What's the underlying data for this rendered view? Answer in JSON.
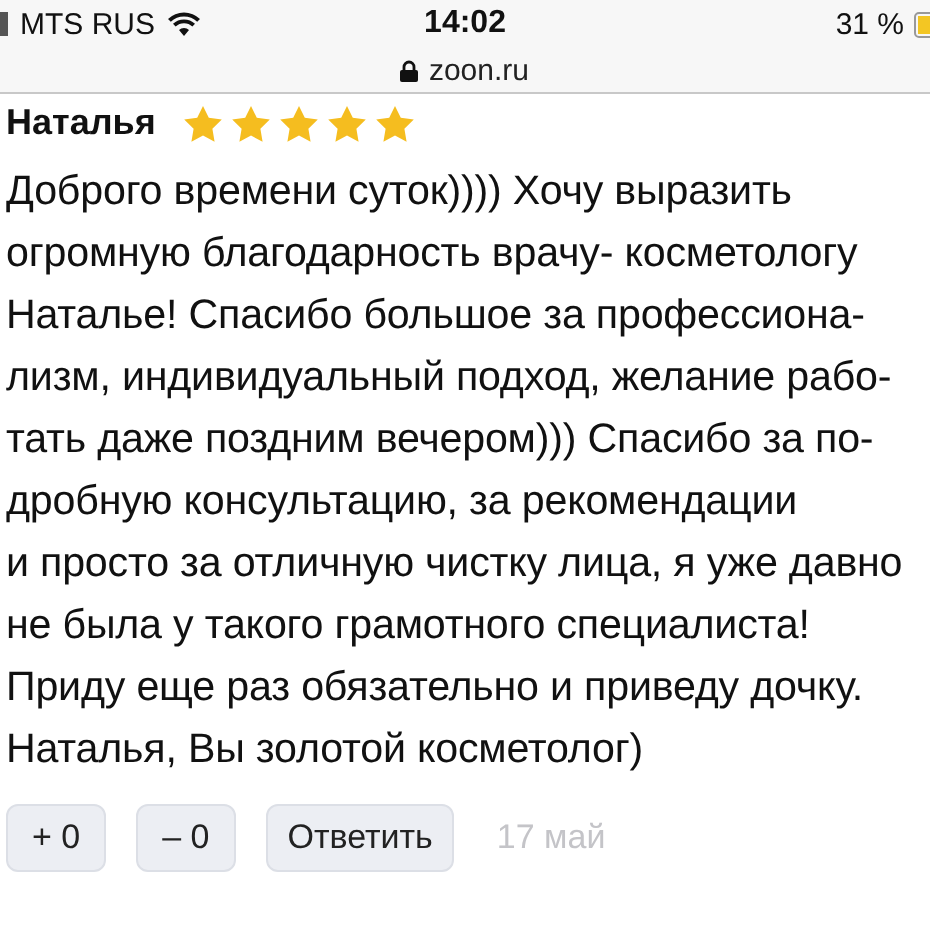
{
  "status_bar": {
    "carrier": "MTS RUS",
    "time": "14:02",
    "battery": "31 %"
  },
  "address_bar": {
    "url": "zoon.ru"
  },
  "review": {
    "author": "Наталья",
    "stars": 5,
    "lines": [
      "Доброго времени суток)))) Хочу выразить",
      "огромную благодарность врачу- косметологу",
      "Наталье! Спасибо большое за профессиона-",
      "лизм, индивидуальный подход, желание рабо-",
      "тать даже поздним вечером))) Спасибо за по-",
      "дробную консультацию, за рекомендации",
      "и просто за отличную чистку лица, я уже давно",
      "не была у такого грамотного специалиста!",
      "Приду еще раз обязательно и приведу дочку.",
      "Наталья, Вы золотой косметолог)"
    ],
    "actions": [
      {
        "kind": "vote",
        "label": "+ 0"
      },
      {
        "kind": "vote",
        "label": "– 0"
      },
      {
        "kind": "reply",
        "label": "Ответить"
      }
    ],
    "date": "17 май"
  }
}
